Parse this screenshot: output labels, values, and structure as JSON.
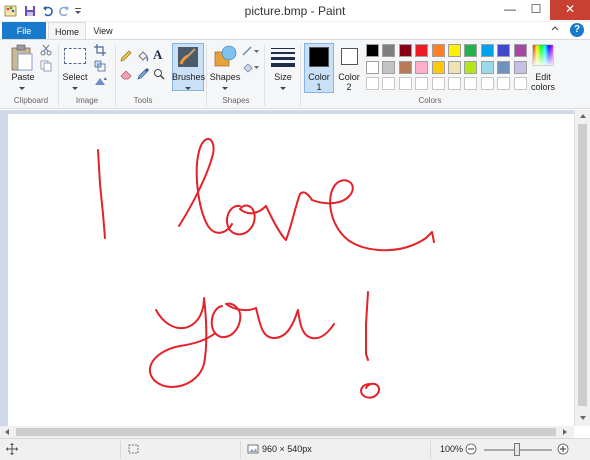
{
  "window": {
    "title": "picture.bmp - Paint",
    "controls": {
      "minimize": "—",
      "maximize": "☐",
      "close": "✕"
    }
  },
  "tabs": [
    {
      "label": "File"
    },
    {
      "label": "Home"
    },
    {
      "label": "View"
    }
  ],
  "help": "?",
  "clipboard": {
    "paste_label": "Paste",
    "group_label": "Clipboard"
  },
  "image": {
    "select_label": "Select",
    "group_label": "Image"
  },
  "tools": {
    "group_label": "Tools",
    "text_tool": "A"
  },
  "brushes": {
    "label": "Brushes"
  },
  "shapes": {
    "label": "Shapes",
    "group_label": "Shapes"
  },
  "size": {
    "label": "Size"
  },
  "color1": {
    "label": "Color",
    "number": "1",
    "value": "#000000"
  },
  "color2": {
    "label": "Color",
    "number": "2",
    "value": "#ffffff"
  },
  "colors": {
    "group_label": "Colors",
    "edit_label_1": "Edit",
    "edit_label_2": "colors",
    "row1": [
      "#000000",
      "#7f7f7f",
      "#880015",
      "#ed1c24",
      "#ff7f27",
      "#fff200",
      "#22b14c",
      "#00a2e8",
      "#3f48cc",
      "#a349a4"
    ],
    "row2": [
      "#ffffff",
      "#c3c3c3",
      "#b97a57",
      "#ffaec9",
      "#ffc90e",
      "#efe4b0",
      "#b5e61d",
      "#99d9ea",
      "#7092be",
      "#c8bfe7"
    ],
    "row3": [
      "#ffffff",
      "#ffffff",
      "#ffffff",
      "#ffffff",
      "#ffffff",
      "#ffffff",
      "#ffffff",
      "#ffffff",
      "#ffffff",
      "#ffffff"
    ]
  },
  "canvas": {
    "ink_color": "#e3222a"
  },
  "status": {
    "dimensions": "960 × 540px",
    "zoom": "100%",
    "zoom_level": 0.5
  }
}
